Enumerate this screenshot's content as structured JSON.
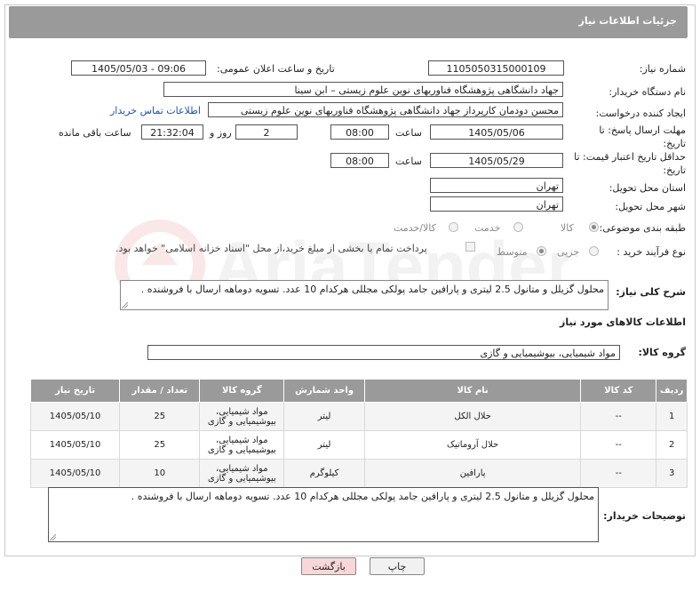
{
  "header": {
    "title": "جزئیات اطلاعات نیاز"
  },
  "fields": {
    "need_number_label": "شماره نیاز:",
    "need_number": "1105050315000109",
    "announce_label": "تاریخ و ساعت اعلان عمومی:",
    "announce_value": "1405/05/03 - 09:06",
    "buyer_org_label": "نام دستگاه خریدار:",
    "buyer_org": "جهاد دانشگاهی پژوهشگاه فناوریهای نوین علوم زیستی – ابن سینا",
    "creator_label": "ایجاد کننده درخواست:",
    "creator": "محسن دودمان کارپرداز جهاد دانشگاهی پژوهشگاه فناوریهای نوین علوم زیستی",
    "contact_link": "اطلاعات تماس خریدار",
    "deadline_label": "مهلت ارسال پاسخ: تا تاریخ:",
    "deadline_date": "1405/05/06",
    "time_label": "ساعت",
    "deadline_time": "08:00",
    "days_value": "2",
    "days_label": "روز و",
    "remaining_time": "21:32:04",
    "remaining_label": "ساعت باقی مانده",
    "validity_label": "حداقل تاریخ اعتبار قیمت: تا تاریخ:",
    "validity_date": "1405/05/29",
    "validity_time": "08:00",
    "province_label": "استان محل تحویل:",
    "province": "تهران",
    "city_label": "شهر محل تحویل:",
    "city": "تهران",
    "category_label": "طبقه بندی موضوعی:",
    "category_options": [
      "کالا",
      "خدمت",
      "کالا/خدمت"
    ],
    "purchase_label": "نوع فرآیند خرید :",
    "purchase_options": [
      "جزیی",
      "متوسط"
    ],
    "payment_note": "پرداخت تمام یا بخشی از مبلغ خرید،از محل \"اسناد خزانه اسلامی\" خواهد بود."
  },
  "summary": {
    "label": "شرح کلی نیاز:",
    "text": "محلول گزیلل و متانول 2.5 لیتری و پارافین جامد پولکی مجللی هرکدام 10 عدد. تسویه دوماهه ارسال با فروشنده ."
  },
  "goods_info_title": "اطلاعات کالاهای مورد نیاز",
  "goods_group": {
    "label": "گروه کالا:",
    "value": "مواد شیمیایی، بیوشیمیایی و گازی"
  },
  "table": {
    "headers": [
      "ردیف",
      "کد کالا",
      "نام کالا",
      "واحد شمارش",
      "گروه کالا",
      "تعداد / مقدار",
      "تاریخ نیاز"
    ],
    "rows": [
      [
        "1",
        "--",
        "حلال الکل",
        "لیتر",
        "مواد شیمیایی، بیوشیمیایی و گازی",
        "25",
        "1405/05/10"
      ],
      [
        "2",
        "--",
        "حلال آروماتیک",
        "لیتر",
        "مواد شیمیایی، بیوشیمیایی و گازی",
        "25",
        "1405/05/10"
      ],
      [
        "3",
        "--",
        "پارافین",
        "کیلوگرم",
        "مواد شیمیایی، بیوشیمیایی و گازی",
        "10",
        "1405/05/10"
      ]
    ]
  },
  "buyer_notes": {
    "label": "توضیحات خریدار:",
    "text": "محلول گزیلل و متانول 2.5 لیتری و پارافین جامد پولکی مجللی هرکدام 10 عدد. تسویه دوماهه ارسال با فروشنده ."
  },
  "buttons": {
    "print": "چاپ",
    "back": "بازگشت"
  },
  "watermark_text": "AriaTender.net",
  "colors": {
    "header_bg": "#9a9a9a",
    "link": "#1a55b0",
    "back_btn_bg": "#f7d7d7"
  }
}
